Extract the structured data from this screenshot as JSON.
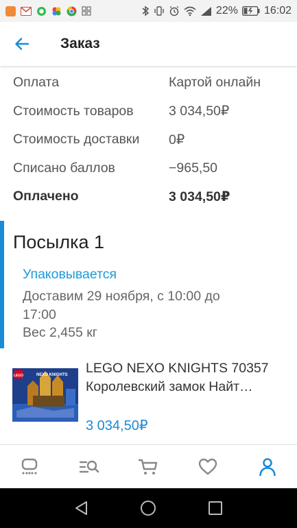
{
  "statusbar": {
    "time": "16:02",
    "battery_percent": "22%",
    "notification_icons": [
      "mail-icon",
      "gmail-icon",
      "whatsapp-icon",
      "photos-icon",
      "chrome-icon",
      "grid-icon"
    ],
    "system_icons": [
      "bluetooth-icon",
      "vibrate-icon",
      "alarm-icon",
      "wifi-icon",
      "signal-icon",
      "battery-charging-icon"
    ]
  },
  "appbar": {
    "title": "Заказ",
    "back_icon": "arrow-left-icon"
  },
  "summary": {
    "rows": [
      {
        "label": "Оплата",
        "value": "Картой онлайн",
        "bold": false
      },
      {
        "label": "Стоимость товаров",
        "value": "3 034,50₽",
        "bold": false
      },
      {
        "label": "Стоимость доставки",
        "value": "0₽",
        "bold": false
      },
      {
        "label": "Списано баллов",
        "value": "−965,50",
        "bold": false
      },
      {
        "label": "Оплачено",
        "value": "3 034,50₽",
        "bold": true
      }
    ]
  },
  "parcel": {
    "title": "Посылка 1",
    "status": "Упаковывается",
    "delivery": "Доставим 29 ноября, с 10:00 до 17:00",
    "weight": "Вес 2,455 кг"
  },
  "product": {
    "name": "LEGO NEXO KNIGHTS 70357 Королевский замок Найт…",
    "price": "3 034,50₽",
    "image_brand_text": "LEGO",
    "image_series_text": "NEXO KNIGHTS"
  },
  "bottomnav": {
    "items": [
      "home-icon",
      "catalog-search-icon",
      "cart-icon",
      "favorites-heart-icon",
      "profile-icon"
    ],
    "active_index": 4
  },
  "colors": {
    "accent": "#1a8bd6",
    "status_blue": "#1a9bdc",
    "text_dark": "#222222",
    "text_grey": "#666666"
  }
}
